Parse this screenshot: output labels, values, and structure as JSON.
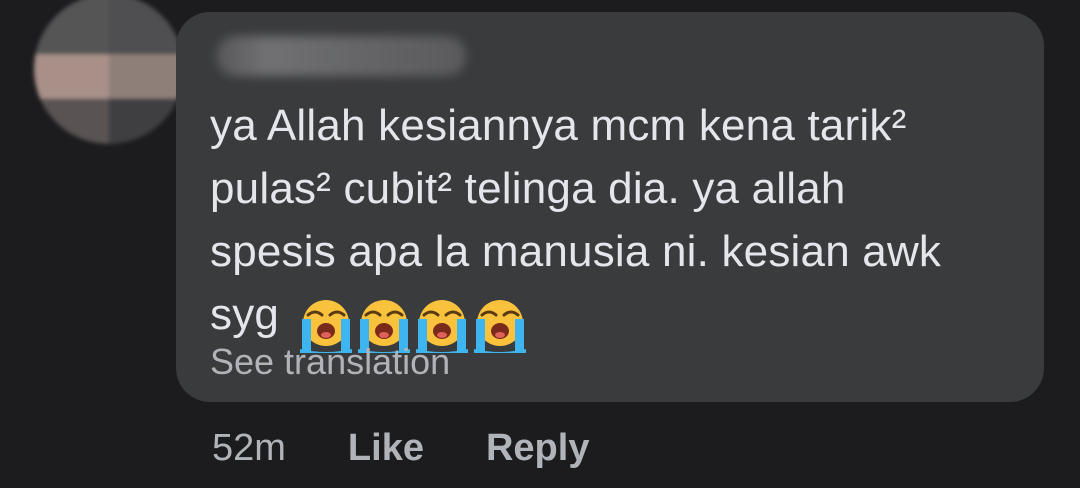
{
  "comment": {
    "lines": [
      "ya Allah kesiannya mcm kena tarik²",
      "pulas² cubit² telinga dia. ya allah",
      "spesis apa la manusia ni. kesian awk",
      "syg"
    ],
    "emoji_name": "loudly-crying-face-icon",
    "emoji_count": 4,
    "see_translation": "See translation"
  },
  "actions": {
    "time": "52m",
    "like": "Like",
    "reply": "Reply"
  },
  "colors": {
    "background": "#1c1c1e",
    "bubble": "#3a3b3c",
    "text": "#e4e6eb",
    "secondary_text": "#b0b3b8",
    "emoji_face": "#f9c23c",
    "emoji_tears": "#3fb5f0"
  }
}
